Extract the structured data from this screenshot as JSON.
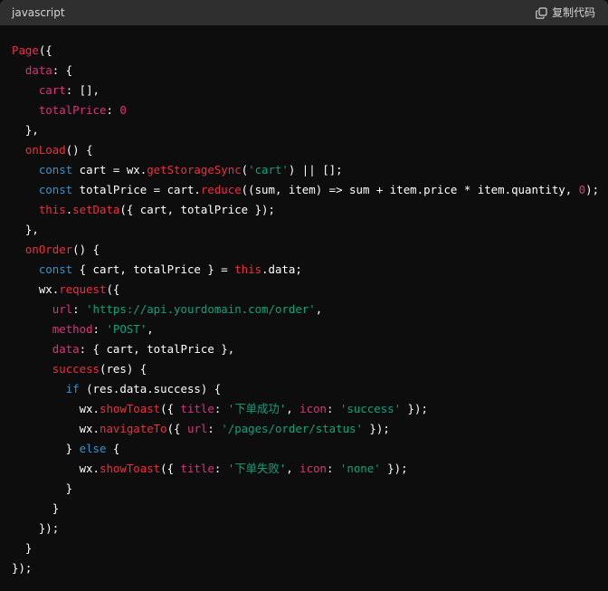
{
  "header": {
    "language": "javascript",
    "copy_label": "复制代码",
    "copy_icon": "copy-icon"
  },
  "colors": {
    "header_bg": "#2f2f2f",
    "code_bg": "#0d0d0d",
    "function": "#f22c3d",
    "property": "#df3079",
    "string": "#00a67d",
    "keyword": "#2e95d3",
    "plain": "#ffffff"
  },
  "code": {
    "lines": [
      [
        {
          "t": "Page",
          "c": "fn"
        },
        {
          "t": "({",
          "c": "plain"
        }
      ],
      [
        {
          "t": "  ",
          "c": "plain"
        },
        {
          "t": "data",
          "c": "prop"
        },
        {
          "t": ": {",
          "c": "plain"
        }
      ],
      [
        {
          "t": "    ",
          "c": "plain"
        },
        {
          "t": "cart",
          "c": "prop"
        },
        {
          "t": ": [],",
          "c": "plain"
        }
      ],
      [
        {
          "t": "    ",
          "c": "plain"
        },
        {
          "t": "totalPrice",
          "c": "prop"
        },
        {
          "t": ": ",
          "c": "plain"
        },
        {
          "t": "0",
          "c": "num"
        }
      ],
      [
        {
          "t": "  },",
          "c": "plain"
        }
      ],
      [
        {
          "t": "  ",
          "c": "plain"
        },
        {
          "t": "onLoad",
          "c": "fn"
        },
        {
          "t": "() {",
          "c": "plain"
        }
      ],
      [
        {
          "t": "    ",
          "c": "plain"
        },
        {
          "t": "const",
          "c": "kw"
        },
        {
          "t": " cart = wx.",
          "c": "plain"
        },
        {
          "t": "getStorageSync",
          "c": "fn"
        },
        {
          "t": "(",
          "c": "plain"
        },
        {
          "t": "'cart'",
          "c": "str"
        },
        {
          "t": ") || [];",
          "c": "plain"
        }
      ],
      [
        {
          "t": "    ",
          "c": "plain"
        },
        {
          "t": "const",
          "c": "kw"
        },
        {
          "t": " totalPrice = cart.",
          "c": "plain"
        },
        {
          "t": "reduce",
          "c": "fn"
        },
        {
          "t": "((sum, item) => sum + item.price * item.quantity, ",
          "c": "plain"
        },
        {
          "t": "0",
          "c": "num"
        },
        {
          "t": ");",
          "c": "plain"
        }
      ],
      [
        {
          "t": "    ",
          "c": "plain"
        },
        {
          "t": "this",
          "c": "this"
        },
        {
          "t": ".",
          "c": "plain"
        },
        {
          "t": "setData",
          "c": "fn"
        },
        {
          "t": "({ cart, totalPrice });",
          "c": "plain"
        }
      ],
      [
        {
          "t": "  },",
          "c": "plain"
        }
      ],
      [
        {
          "t": "  ",
          "c": "plain"
        },
        {
          "t": "onOrder",
          "c": "fn"
        },
        {
          "t": "() {",
          "c": "plain"
        }
      ],
      [
        {
          "t": "    ",
          "c": "plain"
        },
        {
          "t": "const",
          "c": "kw"
        },
        {
          "t": " { cart, totalPrice } = ",
          "c": "plain"
        },
        {
          "t": "this",
          "c": "this"
        },
        {
          "t": ".data;",
          "c": "plain"
        }
      ],
      [
        {
          "t": "    wx.",
          "c": "plain"
        },
        {
          "t": "request",
          "c": "fn"
        },
        {
          "t": "({",
          "c": "plain"
        }
      ],
      [
        {
          "t": "      ",
          "c": "plain"
        },
        {
          "t": "url",
          "c": "prop"
        },
        {
          "t": ": ",
          "c": "plain"
        },
        {
          "t": "'https://api.yourdomain.com/order'",
          "c": "str"
        },
        {
          "t": ",",
          "c": "plain"
        }
      ],
      [
        {
          "t": "      ",
          "c": "plain"
        },
        {
          "t": "method",
          "c": "prop"
        },
        {
          "t": ": ",
          "c": "plain"
        },
        {
          "t": "'POST'",
          "c": "str"
        },
        {
          "t": ",",
          "c": "plain"
        }
      ],
      [
        {
          "t": "      ",
          "c": "plain"
        },
        {
          "t": "data",
          "c": "prop"
        },
        {
          "t": ": { cart, totalPrice },",
          "c": "plain"
        }
      ],
      [
        {
          "t": "      ",
          "c": "plain"
        },
        {
          "t": "success",
          "c": "fn"
        },
        {
          "t": "(res) {",
          "c": "plain"
        }
      ],
      [
        {
          "t": "        ",
          "c": "plain"
        },
        {
          "t": "if",
          "c": "kw"
        },
        {
          "t": " (res.data.success) {",
          "c": "plain"
        }
      ],
      [
        {
          "t": "          wx.",
          "c": "plain"
        },
        {
          "t": "showToast",
          "c": "fn"
        },
        {
          "t": "({ ",
          "c": "plain"
        },
        {
          "t": "title",
          "c": "prop"
        },
        {
          "t": ": ",
          "c": "plain"
        },
        {
          "t": "'下单成功'",
          "c": "str"
        },
        {
          "t": ", ",
          "c": "plain"
        },
        {
          "t": "icon",
          "c": "prop"
        },
        {
          "t": ": ",
          "c": "plain"
        },
        {
          "t": "'success'",
          "c": "str"
        },
        {
          "t": " });",
          "c": "plain"
        }
      ],
      [
        {
          "t": "          wx.",
          "c": "plain"
        },
        {
          "t": "navigateTo",
          "c": "fn"
        },
        {
          "t": "({ ",
          "c": "plain"
        },
        {
          "t": "url",
          "c": "prop"
        },
        {
          "t": ": ",
          "c": "plain"
        },
        {
          "t": "'/pages/order/status'",
          "c": "str"
        },
        {
          "t": " });",
          "c": "plain"
        }
      ],
      [
        {
          "t": "        } ",
          "c": "plain"
        },
        {
          "t": "else",
          "c": "kw"
        },
        {
          "t": " {",
          "c": "plain"
        }
      ],
      [
        {
          "t": "          wx.",
          "c": "plain"
        },
        {
          "t": "showToast",
          "c": "fn"
        },
        {
          "t": "({ ",
          "c": "plain"
        },
        {
          "t": "title",
          "c": "prop"
        },
        {
          "t": ": ",
          "c": "plain"
        },
        {
          "t": "'下单失败'",
          "c": "str"
        },
        {
          "t": ", ",
          "c": "plain"
        },
        {
          "t": "icon",
          "c": "prop"
        },
        {
          "t": ": ",
          "c": "plain"
        },
        {
          "t": "'none'",
          "c": "str"
        },
        {
          "t": " });",
          "c": "plain"
        }
      ],
      [
        {
          "t": "        }",
          "c": "plain"
        }
      ],
      [
        {
          "t": "      }",
          "c": "plain"
        }
      ],
      [
        {
          "t": "    });",
          "c": "plain"
        }
      ],
      [
        {
          "t": "  }",
          "c": "plain"
        }
      ],
      [
        {
          "t": "});",
          "c": "plain"
        }
      ]
    ]
  }
}
